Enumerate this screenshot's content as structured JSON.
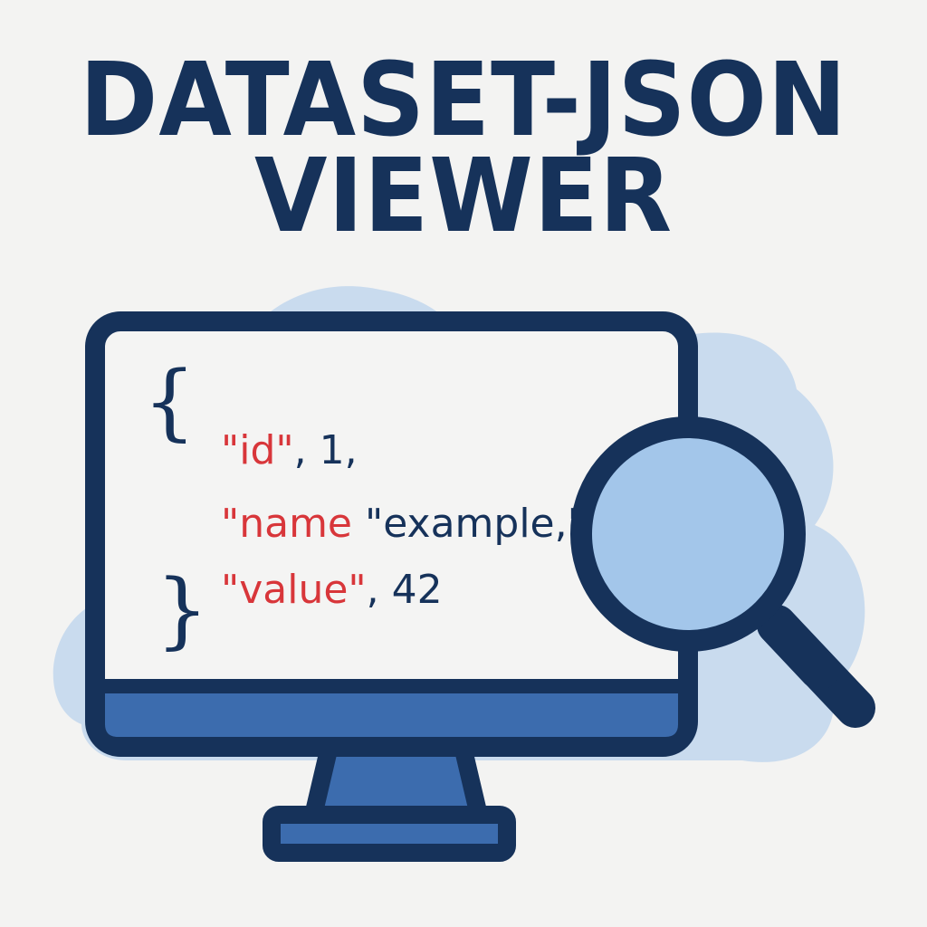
{
  "title": {
    "line1": "DATASET-JSON",
    "line2": "VIEWER"
  },
  "code": {
    "open_brace": "{",
    "close_brace": "}",
    "lines": [
      {
        "key": "\"id\"",
        "rest": ", 1,"
      },
      {
        "key": "\"name",
        "rest": " \"example,\""
      },
      {
        "key": "\"value\"",
        "rest": ", 42"
      }
    ]
  },
  "icons": {
    "monitor": "monitor-icon",
    "magnifier": "magnifying-glass-icon",
    "cloud": "cloud-background"
  },
  "colors": {
    "navy": "#16325a",
    "key_red": "#d8363a",
    "value_navy": "#16325a",
    "screen_bg": "#f4f4f3",
    "monitor_bar": "#3c6cae",
    "cloud": "#c9dbee",
    "lens": "#a3c6ea"
  }
}
